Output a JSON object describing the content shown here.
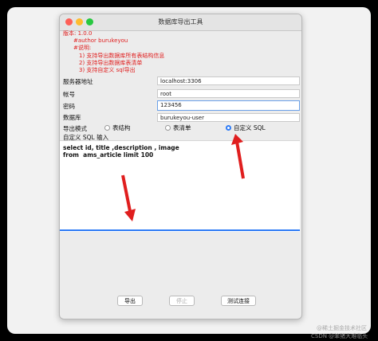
{
  "window": {
    "title": "数据库导出工具"
  },
  "info": {
    "lines": [
      "版本: 1.0.0",
      "#author burukeyou",
      "#说明:",
      "1) 支持导出数据库所有表结构信息",
      "2) 支持导出数据库表清单",
      "3) 支持自定义 sql导出"
    ]
  },
  "form": {
    "server": {
      "label": "服务器地址",
      "value": "localhost:3306"
    },
    "account": {
      "label": "帐号",
      "value": "root"
    },
    "password": {
      "label": "密码",
      "value": "123456"
    },
    "database": {
      "label": "数据库",
      "value": "burukeyou-user"
    },
    "mode": {
      "label": "导出模式",
      "options": [
        "表结构",
        "表清单",
        "自定义 SQL"
      ],
      "selected": "自定义 SQL"
    },
    "sql": {
      "label": "自定义 SQL 输入",
      "line1": "select id, title ,description , image",
      "line2": "from  ams_article limit 100"
    }
  },
  "buttons": {
    "export": "导出",
    "stop": "停止",
    "test": "测试连接"
  },
  "watermark": {
    "line1": "@稀土掘金技术社区",
    "line2": "CSDN @笨猪大难临头"
  },
  "colors": {
    "info_text": "#e02020",
    "accent": "#2f7cf6",
    "arrow": "#e01e1e"
  }
}
